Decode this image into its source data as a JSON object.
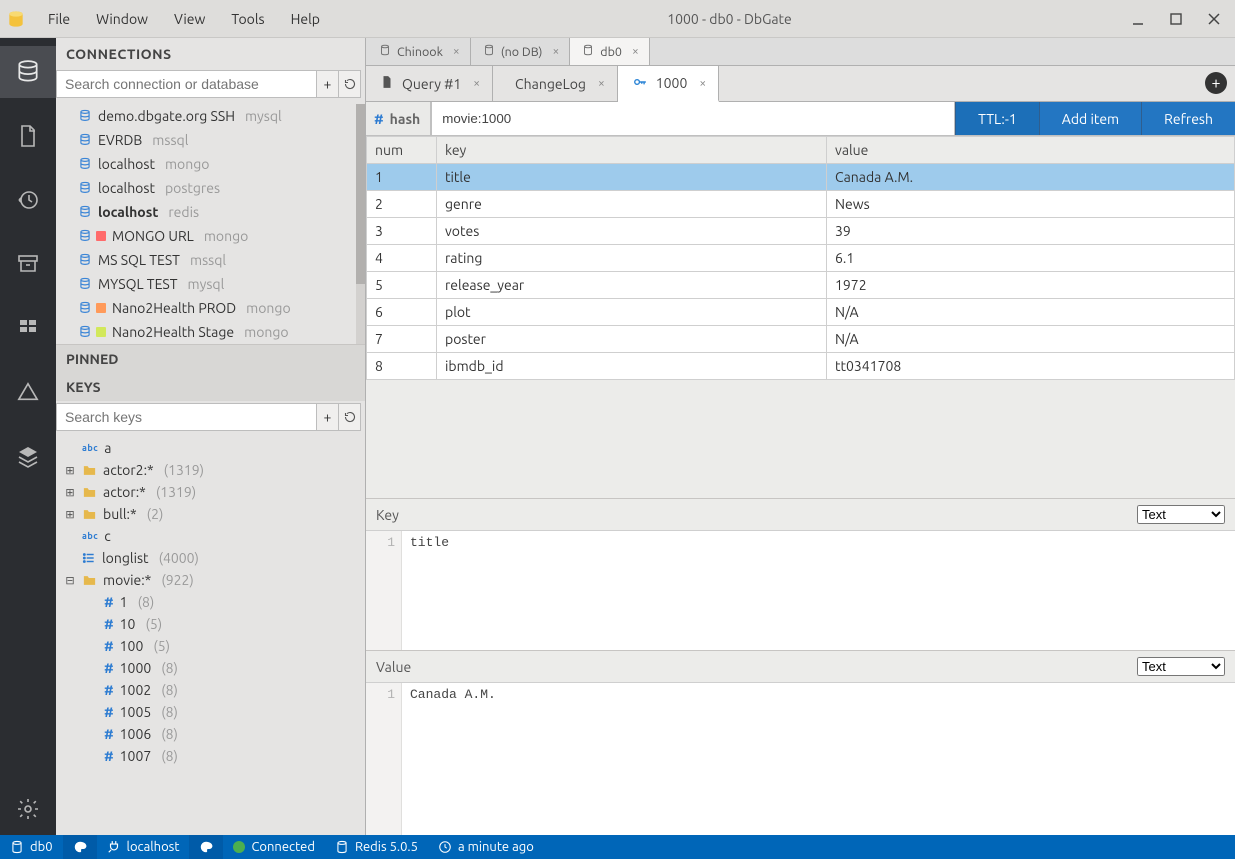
{
  "window": {
    "title": "1000 - db0 - DbGate"
  },
  "menu": {
    "file": "File",
    "window": "Window",
    "view": "View",
    "tools": "Tools",
    "help": "Help"
  },
  "side": {
    "connections_header": "CONNECTIONS",
    "search_placeholder": "Search connection or database",
    "connections": [
      {
        "name": "demo.dbgate.org SSH",
        "engine": "mysql",
        "marker": null
      },
      {
        "name": "EVRDB",
        "engine": "mssql",
        "marker": null
      },
      {
        "name": "localhost",
        "engine": "mongo",
        "marker": null
      },
      {
        "name": "localhost",
        "engine": "postgres",
        "marker": null
      },
      {
        "name": "localhost",
        "engine": "redis",
        "marker": null,
        "bold": true
      },
      {
        "name": "MONGO URL",
        "engine": "mongo",
        "marker": "#ff6b6b"
      },
      {
        "name": "MS SQL TEST",
        "engine": "mssql",
        "marker": null
      },
      {
        "name": "MYSQL TEST",
        "engine": "mysql",
        "marker": null
      },
      {
        "name": "Nano2Health PROD",
        "engine": "mongo",
        "marker": "#ff9a5a"
      },
      {
        "name": "Nano2Health Stage",
        "engine": "mongo",
        "marker": "#d2e85b"
      }
    ],
    "pinned_header": "PINNED",
    "keys_header": "KEYS",
    "keys_search_placeholder": "Search keys",
    "tree": [
      {
        "kind": "abc",
        "label": "a",
        "indent": 1
      },
      {
        "kind": "folder",
        "exp": "plus",
        "label": "actor2:*",
        "count": "(1319)",
        "indent": 0
      },
      {
        "kind": "folder",
        "exp": "plus",
        "label": "actor:*",
        "count": "(1319)",
        "indent": 0
      },
      {
        "kind": "folder",
        "exp": "plus",
        "label": "bull:*",
        "count": "(2)",
        "indent": 0
      },
      {
        "kind": "abc",
        "label": "c",
        "indent": 1
      },
      {
        "kind": "list",
        "label": "longlist",
        "count": "(4000)",
        "indent": 1
      },
      {
        "kind": "folder",
        "exp": "minus",
        "label": "movie:*",
        "count": "(922)",
        "indent": 0
      },
      {
        "kind": "hash",
        "label": "1",
        "count": "(8)",
        "indent": 2
      },
      {
        "kind": "hash",
        "label": "10",
        "count": "(5)",
        "indent": 2
      },
      {
        "kind": "hash",
        "label": "100",
        "count": "(5)",
        "indent": 2
      },
      {
        "kind": "hash",
        "label": "1000",
        "count": "(8)",
        "indent": 2
      },
      {
        "kind": "hash",
        "label": "1002",
        "count": "(8)",
        "indent": 2
      },
      {
        "kind": "hash",
        "label": "1005",
        "count": "(8)",
        "indent": 2
      },
      {
        "kind": "hash",
        "label": "1006",
        "count": "(8)",
        "indent": 2
      },
      {
        "kind": "hash",
        "label": "1007",
        "count": "(8)",
        "indent": 2
      }
    ]
  },
  "outer_tabs": [
    {
      "label": "Chinook",
      "icon": "db",
      "active": false
    },
    {
      "label": "(no DB)",
      "icon": "db",
      "active": false
    },
    {
      "label": "db0",
      "icon": "db",
      "active": true
    }
  ],
  "tabs": [
    {
      "label": "Query #1",
      "icon": "file",
      "color": "#555",
      "active": false
    },
    {
      "label": "ChangeLog",
      "icon": "square",
      "color": "#e15148",
      "active": false
    },
    {
      "label": "1000",
      "icon": "key",
      "color": "#2a84d6",
      "active": true
    }
  ],
  "action": {
    "type_label": "hash",
    "path_value": "movie:1000",
    "ttl_btn": "TTL:-1",
    "add_btn": "Add item",
    "refresh_btn": "Refresh"
  },
  "grid": {
    "cols": {
      "num": "num",
      "key": "key",
      "value": "value"
    },
    "rows": [
      {
        "num": "1",
        "key": "title",
        "value": "Canada A.M.",
        "sel": true
      },
      {
        "num": "2",
        "key": "genre",
        "value": "News",
        "sel": false
      },
      {
        "num": "3",
        "key": "votes",
        "value": "39",
        "sel": false
      },
      {
        "num": "4",
        "key": "rating",
        "value": "6.1",
        "sel": false
      },
      {
        "num": "5",
        "key": "release_year",
        "value": "1972",
        "sel": false
      },
      {
        "num": "6",
        "key": "plot",
        "value": "N/A",
        "sel": false
      },
      {
        "num": "7",
        "key": "poster",
        "value": "N/A",
        "sel": false
      },
      {
        "num": "8",
        "key": "ibmdb_id",
        "value": "tt0341708",
        "sel": false
      }
    ]
  },
  "panes": {
    "key_label": "Key",
    "key_mode_selected": "Text",
    "key_content": "title",
    "value_label": "Value",
    "value_mode_selected": "Text",
    "value_content": "Canada A.M."
  },
  "status": {
    "db": "db0",
    "host": "localhost",
    "state": "Connected",
    "server": "Redis 5.0.5",
    "time": "a minute ago"
  }
}
